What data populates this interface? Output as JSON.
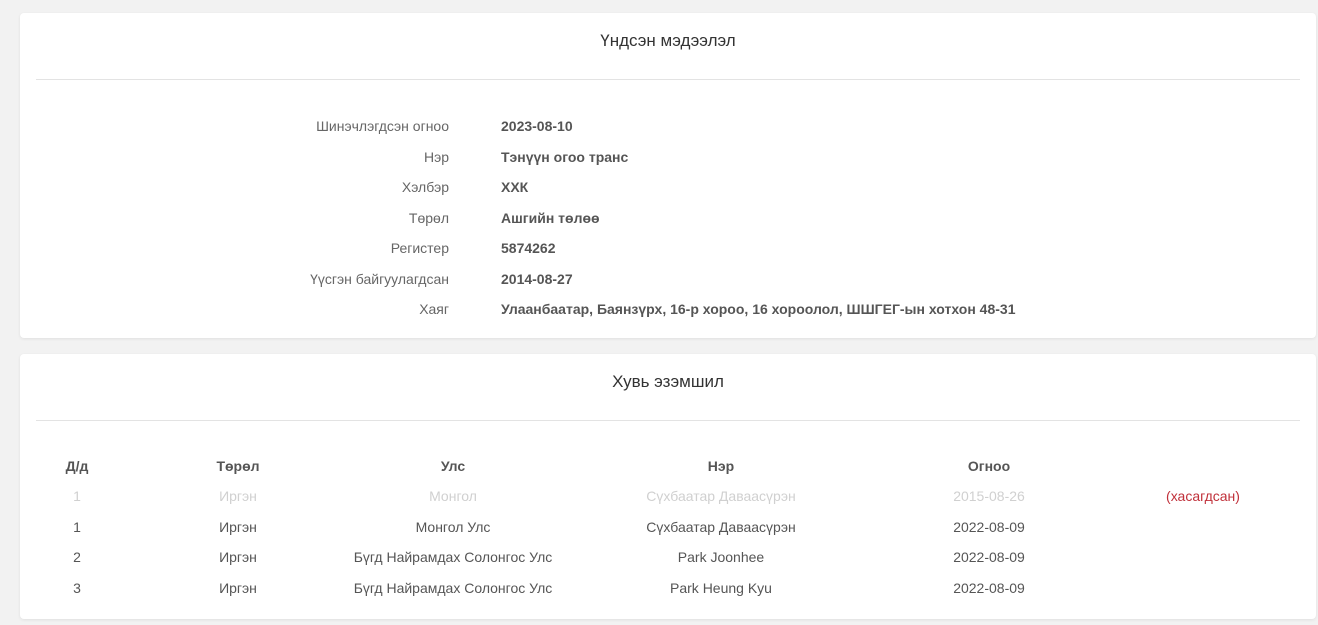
{
  "basic_info": {
    "title": "Үндсэн мэдээлэл",
    "rows": [
      {
        "label": "Шинэчлэгдсэн огноо",
        "value": "2023-08-10"
      },
      {
        "label": "Нэр",
        "value": "Тэнүүн огоо транс"
      },
      {
        "label": "Хэлбэр",
        "value": "ХХК"
      },
      {
        "label": "Төрөл",
        "value": "Ашгийн төлөө"
      },
      {
        "label": "Регистер",
        "value": "5874262"
      },
      {
        "label": "Үүсгэн байгуулагдсан",
        "value": "2014-08-27"
      },
      {
        "label": "Хаяг",
        "value": "Улаанбаатар, Баянзүрх, 16-р хороо, 16 хороолол, ШШГЕГ-ын хотхон 48-31"
      }
    ]
  },
  "shareholding": {
    "title": "Хувь эзэмшил",
    "columns": [
      "Д/д",
      "Төрөл",
      "Улс",
      "Нэр",
      "Огноо",
      ""
    ],
    "rows": [
      {
        "no": "1",
        "type": "Иргэн",
        "country": "Монгол",
        "name": "Сүхбаатар Даваасүрэн",
        "date": "2015-08-26",
        "status": "(хасагдсан)"
      },
      {
        "no": "1",
        "type": "Иргэн",
        "country": "Монгол Улс",
        "name": "Сүхбаатар Даваасүрэн",
        "date": "2022-08-09",
        "status": ""
      },
      {
        "no": "2",
        "type": "Иргэн",
        "country": "Бүгд Найрамдах Солонгос Улс",
        "name": "Park Joonhee",
        "date": "2022-08-09",
        "status": ""
      },
      {
        "no": "3",
        "type": "Иргэн",
        "country": "Бүгд Найрамдах Солонгос Улс",
        "name": "Park Heung Kyu",
        "date": "2022-08-09",
        "status": ""
      }
    ]
  },
  "colors": {
    "removed_text": "#d0d0d0",
    "removed_tag": "#c0303a",
    "page_background": "#f2f2f2"
  }
}
